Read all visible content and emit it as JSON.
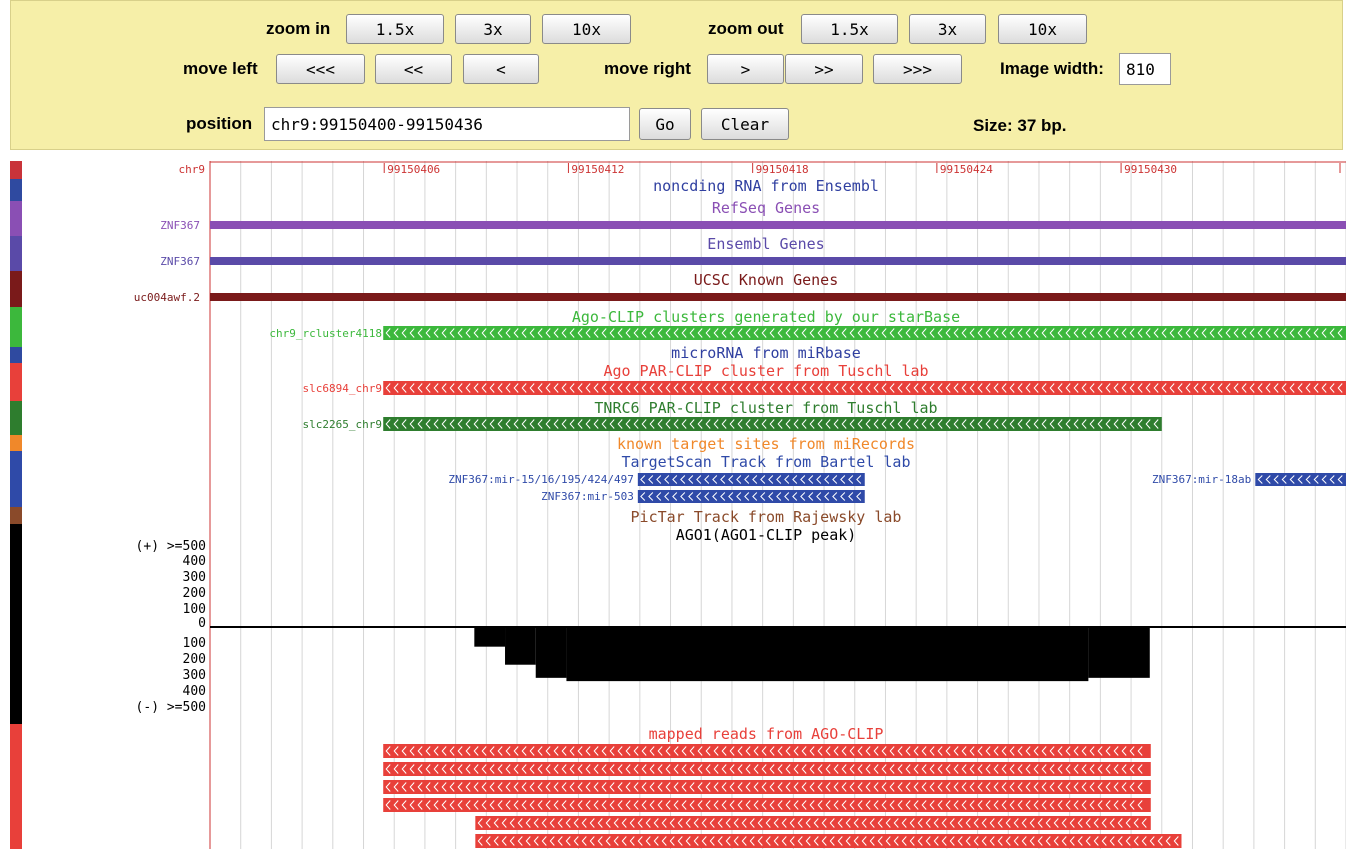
{
  "nav": {
    "zoom_in_label": "zoom in",
    "zoom_out_label": "zoom out",
    "move_left_label": "move left",
    "move_right_label": "move right",
    "image_width_label": "Image width:",
    "image_width_value": "810",
    "zoom_in": [
      "1.5x",
      "3x",
      "10x"
    ],
    "zoom_out": [
      "1.5x",
      "3x",
      "10x"
    ],
    "left": [
      "<<<",
      "<<",
      "<"
    ],
    "right": [
      ">",
      ">>",
      ">>>"
    ]
  },
  "position": {
    "label": "position",
    "value": "chr9:99150400-99150436",
    "go": "Go",
    "clear": "Clear",
    "size": "Size: 37 bp."
  },
  "ruler": {
    "chrom": "chr9",
    "ticks": [
      {
        "pos": 99150406,
        "label": "99150406"
      },
      {
        "pos": 99150412,
        "label": "99150412"
      },
      {
        "pos": 99150418,
        "label": "99150418"
      },
      {
        "pos": 99150424,
        "label": "99150424"
      },
      {
        "pos": 99150430,
        "label": "99150430"
      }
    ]
  },
  "tracks": [
    {
      "title": "noncding RNA from Ensembl",
      "color": "#2f3fa0"
    },
    {
      "title": "RefSeq Genes",
      "color": "#8a4fb4",
      "item": "ZNF367",
      "start": 99150400,
      "end": 99150437,
      "style": "line"
    },
    {
      "title": "Ensembl Genes",
      "color": "#5a4aa8",
      "item": "ZNF367",
      "start": 99150400,
      "end": 99150437,
      "style": "line"
    },
    {
      "title": "UCSC Known Genes",
      "color": "#7a1a1a",
      "item": "uc004awf.2",
      "start": 99150400,
      "end": 99150437,
      "style": "line"
    },
    {
      "title": "Ago-CLIP clusters generated by our starBase",
      "color": "#3cb83c",
      "item": "chr9_rcluster4118",
      "start": 99150406,
      "end": 99150437,
      "style": "block"
    },
    {
      "title": "microRNA from miRbase",
      "color": "#2f3fa0"
    },
    {
      "title": "Ago PAR-CLIP cluster from Tuschl lab",
      "color": "#e8403a",
      "item": "slc6894_chr9",
      "start": 99150406,
      "end": 99150437,
      "style": "block"
    },
    {
      "title": "TNRC6 PAR-CLIP cluster from Tuschl lab",
      "color": "#2e7d2e",
      "item": "slc2265_chr9",
      "start": 99150406,
      "end": 99150431,
      "style": "block"
    },
    {
      "title": "known target sites from miRecords",
      "color": "#f0882a"
    },
    {
      "title": "TargetScan Track from Bartel lab",
      "color": "#2f4aa8"
    },
    {
      "title": "PicTar Track from Rajewsky lab",
      "color": "#8a4a2a"
    },
    {
      "title": "AGO1(AGO1-CLIP peak)",
      "color": "#000000"
    },
    {
      "title": "mapped reads from AGO-CLIP",
      "color": "#e8403a"
    }
  ],
  "targetscan": [
    {
      "label": "ZNF367:mir-15/16/195/424/497",
      "start": 99150414,
      "end": 99150421
    },
    {
      "label": "ZNF367:mir-503",
      "start": 99150414,
      "end": 99150421
    },
    {
      "label": "ZNF367:mir-18ab",
      "start": 99150436,
      "end": 99150437
    }
  ],
  "signal": {
    "pos_labels": [
      "(+) >=500",
      "400",
      "300",
      "200",
      "100",
      "0"
    ],
    "neg_labels": [
      "100",
      "200",
      "300",
      "400",
      "(-) >=500"
    ],
    "negative_values": [
      {
        "start": 99150409,
        "end": 99150410,
        "value": 120
      },
      {
        "start": 99150410,
        "end": 99150411,
        "value": 230
      },
      {
        "start": 99150411,
        "end": 99150412,
        "value": 310
      },
      {
        "start": 99150412,
        "end": 99150429,
        "value": 330
      },
      {
        "start": 99150429,
        "end": 99150431,
        "value": 310
      }
    ]
  },
  "reads": [
    {
      "start": 99150406,
      "end": 99150431
    },
    {
      "start": 99150406,
      "end": 99150431
    },
    {
      "start": 99150406,
      "end": 99150431
    },
    {
      "start": 99150406,
      "end": 99150431
    },
    {
      "start": 99150409,
      "end": 99150431
    },
    {
      "start": 99150409,
      "end": 99150432
    }
  ]
}
